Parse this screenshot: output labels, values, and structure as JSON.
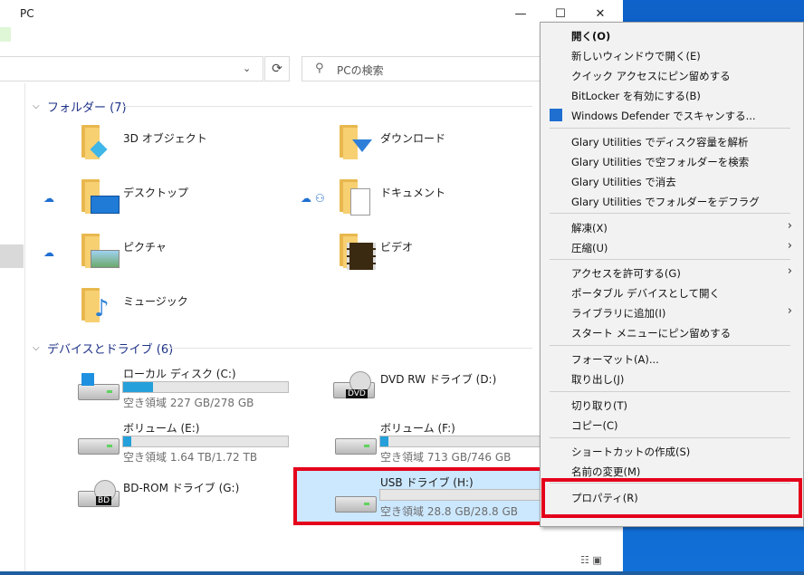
{
  "window": {
    "title": "PC",
    "minimize": "—",
    "maximize": "☐",
    "close": "✕"
  },
  "address": {
    "refresh_icon": "⟳",
    "dropdown_icon": "⌄",
    "search_placeholder": "PCの検索"
  },
  "groups": {
    "folders_header": "フォルダー (7)",
    "drives_header": "デバイスとドライブ (6)"
  },
  "folders": [
    {
      "label": "3D オブジェクト"
    },
    {
      "label": "ダウンロード"
    },
    {
      "label": "デスクトップ"
    },
    {
      "label": "ドキュメント"
    },
    {
      "label": "ピクチャ"
    },
    {
      "label": "ビデオ"
    },
    {
      "label": "ミュージック"
    }
  ],
  "drives": [
    {
      "name": "ローカル ディスク (C:)",
      "free": "空き領域 227 GB/278 GB",
      "used_fraction": 0.18
    },
    {
      "name": "DVD RW ドライブ (D:)",
      "badge": "DVD"
    },
    {
      "name": "ボリューム (E:)",
      "free": "空き領域 1.64 TB/1.72 TB",
      "used_fraction": 0.05
    },
    {
      "name": "ボリューム (F:)",
      "free": "空き領域 713 GB/746 GB",
      "used_fraction": 0.05
    },
    {
      "name": "BD-ROM ドライブ (G:)",
      "badge": "BD"
    },
    {
      "name": "USB ドライブ (H:)",
      "free": "空き領域 28.8 GB/28.8 GB",
      "used_fraction": 0.0
    }
  ],
  "context_menu": {
    "items": [
      {
        "label": "開く(O)"
      },
      {
        "label": "新しいウィンドウで開く(E)"
      },
      {
        "label": "クイック アクセスにピン留めする"
      },
      {
        "label": "BitLocker を有効にする(B)"
      },
      {
        "label": "Windows Defender でスキャンする..."
      },
      {
        "label": "Glary Utilities でディスク容量を解析"
      },
      {
        "label": "Glary Utilities で空フォルダーを検索"
      },
      {
        "label": "Glary Utilities で消去"
      },
      {
        "label": "Glary Utilities でフォルダーをデフラグ"
      },
      {
        "label": "解凍(X)"
      },
      {
        "label": "圧縮(U)"
      },
      {
        "label": "アクセスを許可する(G)"
      },
      {
        "label": "ポータブル デバイスとして開く"
      },
      {
        "label": "ライブラリに追加(I)"
      },
      {
        "label": "スタート メニューにピン留めする"
      },
      {
        "label": "フォーマット(A)..."
      },
      {
        "label": "取り出し(J)"
      },
      {
        "label": "切り取り(T)"
      },
      {
        "label": "コピー(C)"
      },
      {
        "label": "ショートカットの作成(S)"
      },
      {
        "label": "名前の変更(M)"
      },
      {
        "label": "プロパティ(R)"
      }
    ],
    "submenu_arrow": "›"
  },
  "colors": {
    "accent_blue": "#26a0da",
    "selection": "#cce8ff",
    "highlight_red": "#e4001b",
    "group_header": "#1e3287"
  }
}
